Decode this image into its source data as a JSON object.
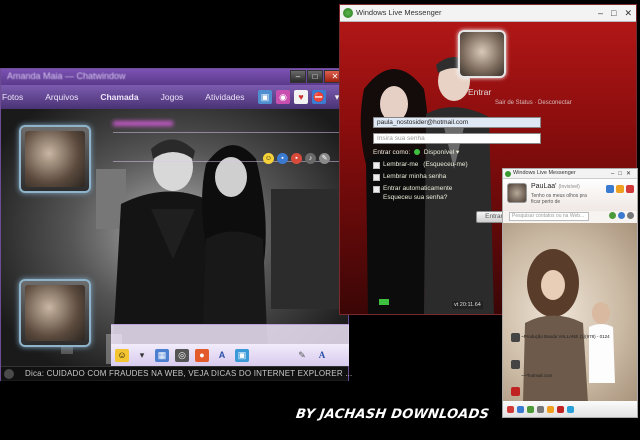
{
  "chat_window": {
    "title": "Amanda Maia — Chatwindow",
    "menu": [
      "Fotos",
      "Arquivos",
      "Chamada",
      "Jogos",
      "Atividades"
    ],
    "status_text": "Dica: CUIDADO COM FRAUDES NA WEB, VEJA DICAS DO INTERNET EXPLORER ..."
  },
  "login_window": {
    "title": "Windows Live Messenger",
    "enter_label": "Entrar",
    "top_links": "Sair de Status · Desconectar",
    "email_value": "paula_nostosider@hotmail.com",
    "password_placeholder": "Insira sua senha",
    "status_label": "Entrar como:",
    "status_value": "Disponível",
    "remember_me": "Lembrar-me",
    "forgot_me": "(Esqueceu-me)",
    "remember_password": "Lembrar minha senha",
    "auto_signin": "Entrar automaticamente",
    "forgot_password": "Esqueceu sua senha?",
    "enter_button": "Entrar",
    "corner_badge": "vt 20:11.64"
  },
  "small_window": {
    "title": "Windows Live Messenger",
    "user_name": "PauLaa'",
    "user_status": "(Invisível)",
    "personal_message": "Tenho os meus olhos pra ficar perto de",
    "search_placeholder": "Pesquisar contatos ou na Web...",
    "row_texts": [
      "~Produção Banda VALLANE (1)(978) - 0124",
      "~~*hotmail.com"
    ]
  },
  "credit": "BY JACHASH DOWNLOADS",
  "colors": {
    "chat_titlebar": "#6a46a0",
    "login_bg": "#a81616",
    "status_green": "#3fbf3f"
  }
}
